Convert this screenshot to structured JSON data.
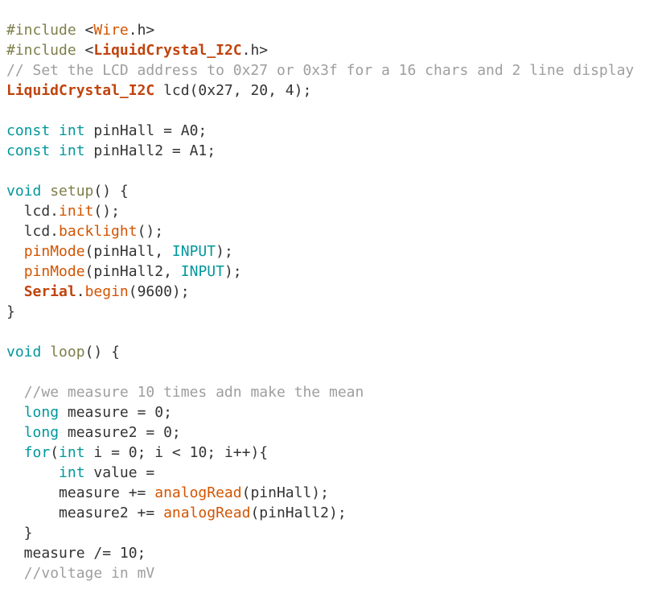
{
  "editor": {
    "language": "arduino-cpp",
    "background_color": "#ffffff",
    "font_size_px": 18,
    "line_height_px": 25
  },
  "theme": {
    "plain": "#333333",
    "preprocessor": "#7E7E4A",
    "keyword": "#00979C",
    "function": "#D35400",
    "type": "#C0440E",
    "comment": "#9E9E9E",
    "number": "#333333"
  },
  "code": {
    "lines": [
      {
        "n": 1,
        "tokens": [
          {
            "t": "#include ",
            "c": "pre"
          },
          {
            "t": "<",
            "c": "plain"
          },
          {
            "t": "Wire",
            "c": "fn"
          },
          {
            "t": ".h>",
            "c": "plain"
          }
        ]
      },
      {
        "n": 2,
        "tokens": [
          {
            "t": "#include ",
            "c": "pre"
          },
          {
            "t": "<",
            "c": "plain"
          },
          {
            "t": "LiquidCrystal_I2C",
            "c": "type"
          },
          {
            "t": ".h>",
            "c": "plain"
          }
        ]
      },
      {
        "n": 3,
        "tokens": [
          {
            "t": "// Set the LCD address to 0x27 or 0x3f for a 16 chars and 2 line display",
            "c": "comment"
          }
        ]
      },
      {
        "n": 4,
        "tokens": [
          {
            "t": "LiquidCrystal_I2C",
            "c": "type"
          },
          {
            "t": " lcd(0x27, 20, 4);",
            "c": "plain"
          }
        ]
      },
      {
        "n": 5,
        "tokens": []
      },
      {
        "n": 6,
        "tokens": [
          {
            "t": "const",
            "c": "kw"
          },
          {
            "t": " ",
            "c": "plain"
          },
          {
            "t": "int",
            "c": "kw"
          },
          {
            "t": " pinHall = A0;",
            "c": "plain"
          }
        ]
      },
      {
        "n": 7,
        "tokens": [
          {
            "t": "const",
            "c": "kw"
          },
          {
            "t": " ",
            "c": "plain"
          },
          {
            "t": "int",
            "c": "kw"
          },
          {
            "t": " pinHall2 = A1;",
            "c": "plain"
          }
        ]
      },
      {
        "n": 8,
        "tokens": []
      },
      {
        "n": 9,
        "tokens": [
          {
            "t": "void",
            "c": "kw"
          },
          {
            "t": " ",
            "c": "plain"
          },
          {
            "t": "setup",
            "c": "pre"
          },
          {
            "t": "() {",
            "c": "plain"
          }
        ]
      },
      {
        "n": 10,
        "tokens": [
          {
            "t": "  lcd.",
            "c": "plain"
          },
          {
            "t": "init",
            "c": "fn"
          },
          {
            "t": "();",
            "c": "plain"
          }
        ]
      },
      {
        "n": 11,
        "tokens": [
          {
            "t": "  lcd.",
            "c": "plain"
          },
          {
            "t": "backlight",
            "c": "fn"
          },
          {
            "t": "();",
            "c": "plain"
          }
        ]
      },
      {
        "n": 12,
        "tokens": [
          {
            "t": "  ",
            "c": "plain"
          },
          {
            "t": "pinMode",
            "c": "fn"
          },
          {
            "t": "(pinHall, ",
            "c": "plain"
          },
          {
            "t": "INPUT",
            "c": "kw"
          },
          {
            "t": ");",
            "c": "plain"
          }
        ]
      },
      {
        "n": 13,
        "tokens": [
          {
            "t": "  ",
            "c": "plain"
          },
          {
            "t": "pinMode",
            "c": "fn"
          },
          {
            "t": "(pinHall2, ",
            "c": "plain"
          },
          {
            "t": "INPUT",
            "c": "kw"
          },
          {
            "t": ");",
            "c": "plain"
          }
        ]
      },
      {
        "n": 14,
        "tokens": [
          {
            "t": "  ",
            "c": "plain"
          },
          {
            "t": "Serial",
            "c": "type"
          },
          {
            "t": ".",
            "c": "plain"
          },
          {
            "t": "begin",
            "c": "fn"
          },
          {
            "t": "(9600);",
            "c": "plain"
          }
        ]
      },
      {
        "n": 15,
        "tokens": [
          {
            "t": "}",
            "c": "plain"
          }
        ]
      },
      {
        "n": 16,
        "tokens": []
      },
      {
        "n": 17,
        "tokens": [
          {
            "t": "void",
            "c": "kw"
          },
          {
            "t": " ",
            "c": "plain"
          },
          {
            "t": "loop",
            "c": "pre"
          },
          {
            "t": "() {",
            "c": "plain"
          }
        ]
      },
      {
        "n": 18,
        "tokens": []
      },
      {
        "n": 19,
        "tokens": [
          {
            "t": "  ",
            "c": "plain"
          },
          {
            "t": "//we measure 10 times adn make the mean",
            "c": "comment"
          }
        ]
      },
      {
        "n": 20,
        "tokens": [
          {
            "t": "  ",
            "c": "plain"
          },
          {
            "t": "long",
            "c": "kw"
          },
          {
            "t": " measure = 0;",
            "c": "plain"
          }
        ]
      },
      {
        "n": 21,
        "tokens": [
          {
            "t": "  ",
            "c": "plain"
          },
          {
            "t": "long",
            "c": "kw"
          },
          {
            "t": " measure2 = 0;",
            "c": "plain"
          }
        ]
      },
      {
        "n": 22,
        "tokens": [
          {
            "t": "  ",
            "c": "plain"
          },
          {
            "t": "for",
            "c": "kw"
          },
          {
            "t": "(",
            "c": "plain"
          },
          {
            "t": "int",
            "c": "kw"
          },
          {
            "t": " i = 0; i < 10; i++){",
            "c": "plain"
          }
        ]
      },
      {
        "n": 23,
        "tokens": [
          {
            "t": "      ",
            "c": "plain"
          },
          {
            "t": "int",
            "c": "kw"
          },
          {
            "t": " value =",
            "c": "plain"
          }
        ]
      },
      {
        "n": 24,
        "tokens": [
          {
            "t": "      measure += ",
            "c": "plain"
          },
          {
            "t": "analogRead",
            "c": "fn"
          },
          {
            "t": "(pinHall);",
            "c": "plain"
          }
        ]
      },
      {
        "n": 25,
        "tokens": [
          {
            "t": "      measure2 += ",
            "c": "plain"
          },
          {
            "t": "analogRead",
            "c": "fn"
          },
          {
            "t": "(pinHall2);",
            "c": "plain"
          }
        ]
      },
      {
        "n": 26,
        "tokens": [
          {
            "t": "  }",
            "c": "plain"
          }
        ]
      },
      {
        "n": 27,
        "tokens": [
          {
            "t": "  measure /= 10;",
            "c": "plain"
          }
        ]
      },
      {
        "n": 28,
        "tokens": [
          {
            "t": "  ",
            "c": "plain"
          },
          {
            "t": "//voltage in mV",
            "c": "comment"
          }
        ]
      }
    ]
  }
}
